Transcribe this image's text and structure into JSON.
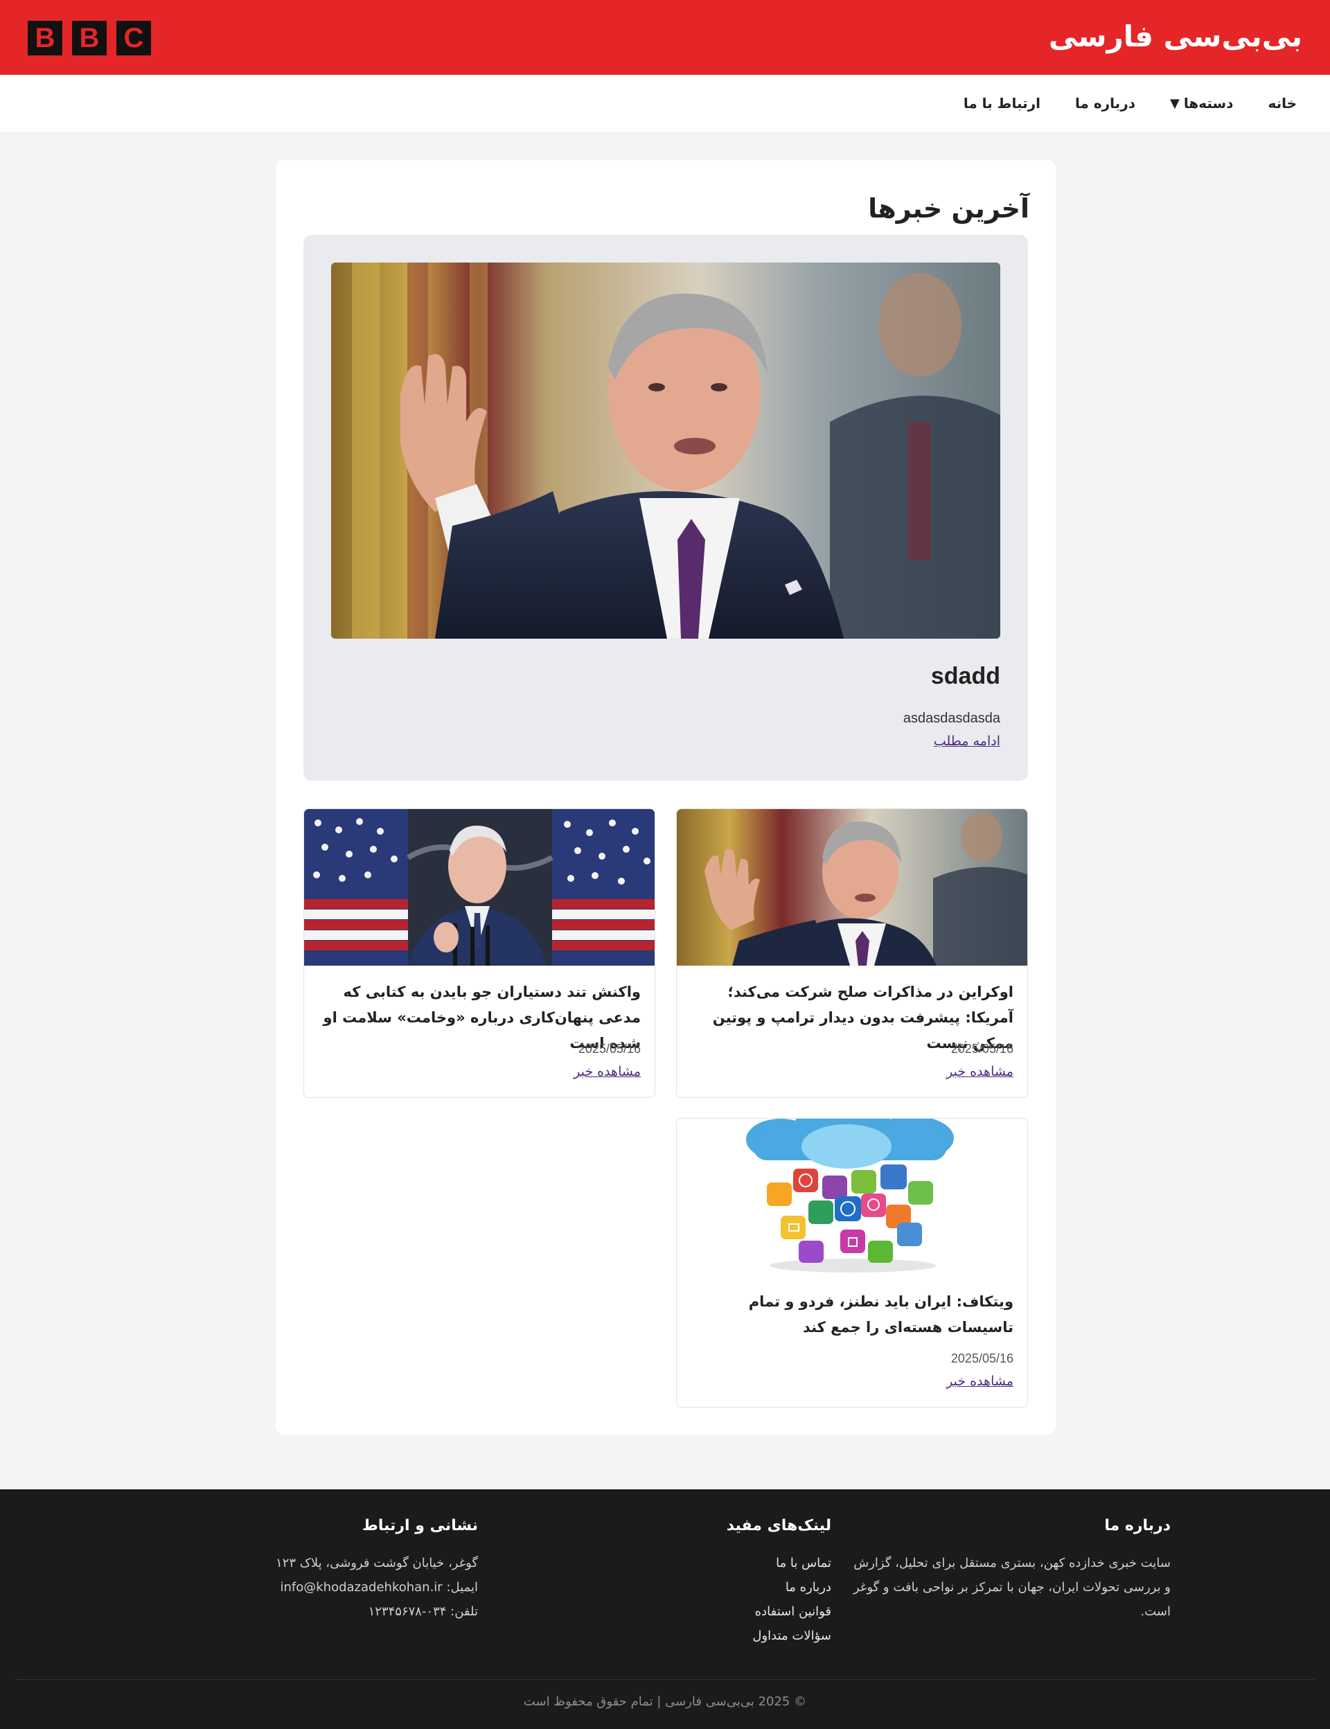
{
  "header": {
    "site_title": "بی‌بی‌سی فارسی",
    "logo_letters": [
      "B",
      "B",
      "C"
    ]
  },
  "nav": {
    "items": [
      {
        "label": "خانه"
      },
      {
        "label": "دسته‌ها",
        "has_dropdown": true,
        "caret": "▼"
      },
      {
        "label": "درباره ما"
      },
      {
        "label": "ارتباط با ما"
      }
    ]
  },
  "main": {
    "section_title": "آخرین خبرها",
    "featured": {
      "image": "man-raising-hand-portrait",
      "title": "sdadd",
      "summary": "asdasdasdasda",
      "link_label": "ادامه مطلب"
    },
    "news": [
      {
        "image": "man-raising-hand-portrait",
        "headline": "اوکراین در مذاکرات صلح شرکت می‌کند؛ آمریکا: پیشرفت بدون دیدار ترامپ و پوتین ممکن نیست",
        "date": "2025/05/16",
        "link_label": "مشاهده خبر"
      },
      {
        "image": "man-speaking-flags",
        "headline": "واکنش تند دستیاران جو بایدن به کتابی که مدعی پنهان‌کاری درباره «وخامت» سلامت او شده است",
        "date": "2025/05/16",
        "link_label": "مشاهده خبر"
      },
      {
        "image": "cloud-app-icons",
        "headline": "ویتکاف: ایران باید نطنز، فردو و تمام تاسیسات هسته‌ای را جمع کند",
        "date": "2025/05/16",
        "link_label": "مشاهده خبر"
      }
    ]
  },
  "footer": {
    "about": {
      "title": "درباره ما",
      "text": "سایت خبری خدازده کهن، بستری مستقل برای تحلیل، گزارش و بررسی تحولات ایران، جهان با تمرکز بر نواحی بافت و گوغر است."
    },
    "links": {
      "title": "لینک‌های مفید",
      "items": [
        "تماس با ما",
        "درباره ما",
        "قوانین استفاده",
        "سؤالات متداول"
      ]
    },
    "contact": {
      "title": "نشانی و ارتباط",
      "address": "گوغر، خیابان گوشت فروشی، پلاک ۱۲۳",
      "email": "ایمیل: info@khodazadehkohan.ir",
      "phone": "تلفن: ۰۳۴-۱۲۳۴۵۶۷۸"
    },
    "copyright": "© 2025 بی‌بی‌سی فارسی | تمام حقوق محفوظ است"
  },
  "colors": {
    "brand_red": "#e52628",
    "link": "#4a2a80",
    "footer_bg": "#1b1b1c"
  }
}
